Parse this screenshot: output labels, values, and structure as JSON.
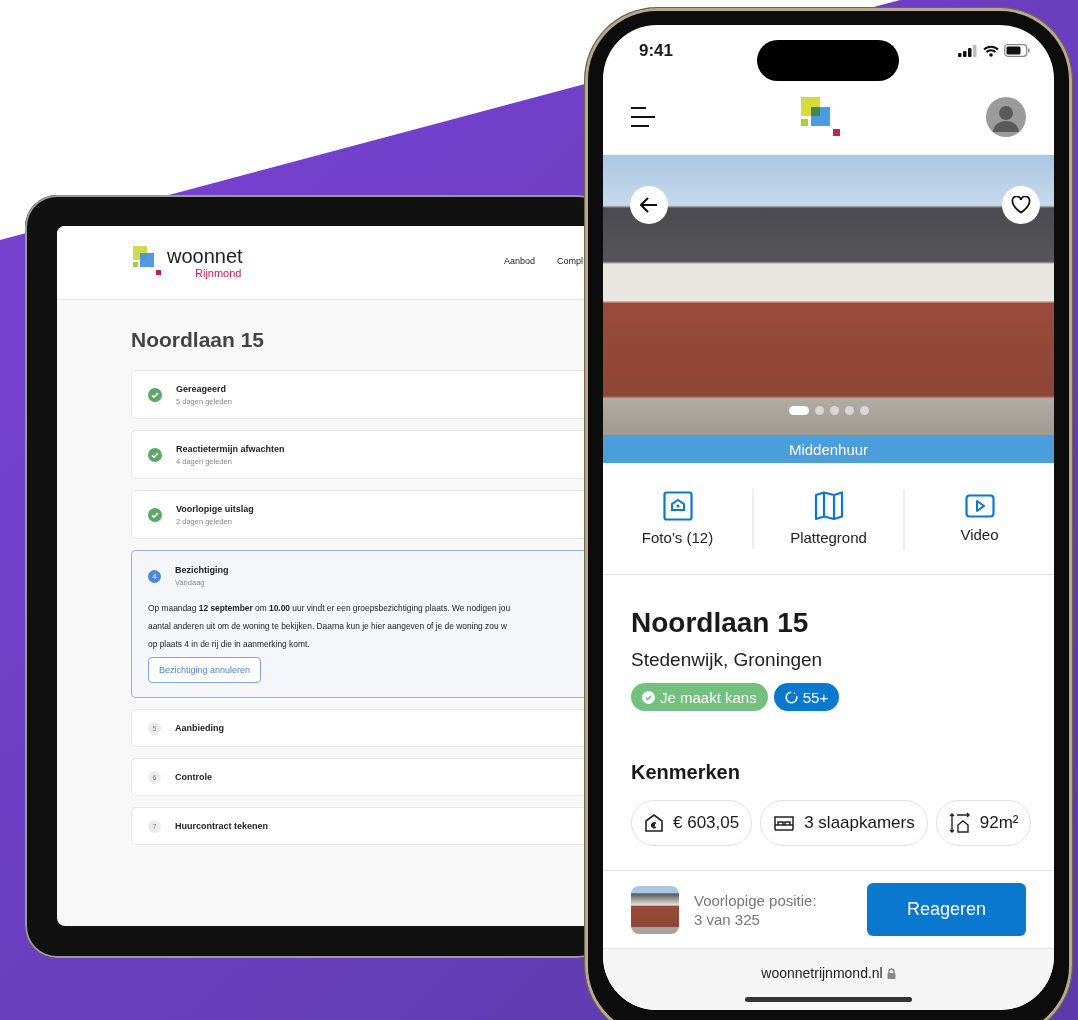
{
  "tablet": {
    "logo": {
      "name": "woonnet",
      "subname": "Rijnmond"
    },
    "nav": [
      "Aanbod",
      "Compl"
    ],
    "title": "Noordlaan 15",
    "steps": [
      {
        "completed": true,
        "active": false,
        "title": "Gereageerd",
        "subtitle": "5 dagen geleden"
      },
      {
        "completed": true,
        "active": false,
        "title": "Reactietermijn afwachten",
        "subtitle": "4 dagen geleden"
      },
      {
        "completed": true,
        "active": false,
        "title": "Voorlopige uitslag",
        "subtitle": "2 dagen geleden"
      },
      {
        "completed": false,
        "active": true,
        "number": "4",
        "title": "Bezichtiging",
        "subtitle": "Vandaag",
        "body_lines": [
          "Op maandag **12 september** om **10.00** uur vindt er een groepsbezichtiging plaats. We nodigen jou",
          "aantal anderen uit om de woning te bekijken. Daarna kun je hier aangeven of je de woning zou w",
          "op plaats 4 in de rij die in aanmerking komt."
        ],
        "button": "Bezichtiging annuleren"
      },
      {
        "completed": false,
        "active": false,
        "number": "5",
        "title": "Aanbieding"
      },
      {
        "completed": false,
        "active": false,
        "number": "6",
        "title": "Controle"
      },
      {
        "completed": false,
        "active": false,
        "number": "7",
        "title": "Huurcontract tekenen"
      }
    ]
  },
  "phone": {
    "status_bar": {
      "time": "9:41"
    },
    "photo_dots": [
      {
        "selected": true
      },
      {
        "selected": false
      },
      {
        "selected": false
      },
      {
        "selected": false
      },
      {
        "selected": false
      }
    ],
    "category": "Middenhuur",
    "media_tabs": [
      {
        "kind": "photos",
        "label": "Foto’s (12)"
      },
      {
        "kind": "floorplan",
        "label": "Plattegrond"
      },
      {
        "kind": "video",
        "label": "Video"
      }
    ],
    "title": "Noordlaan 15",
    "location": "Stedenwijk, Groningen",
    "badges": [
      {
        "kind": "chance",
        "label": "Je maakt kans",
        "color": "#73c17f"
      },
      {
        "kind": "age",
        "label": "55+",
        "color": "#0a78cf"
      }
    ],
    "features_heading": "Kenmerken",
    "features": [
      {
        "kind": "rent",
        "label": "€ 603,05"
      },
      {
        "kind": "bedrooms",
        "label": "3 slaapkamers"
      },
      {
        "kind": "area",
        "label": "92m²"
      }
    ],
    "position": {
      "label": "Voorlopige positie:",
      "value": "3 van 325"
    },
    "action_button": "Reageren",
    "url": "woonnetrijnmond.nl"
  }
}
